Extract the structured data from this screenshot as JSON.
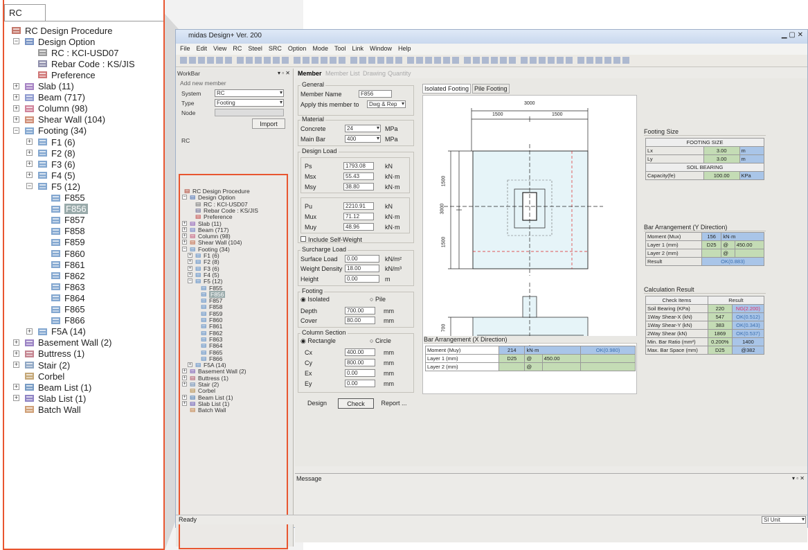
{
  "zoom_panel": {
    "tab": "RC",
    "tree": [
      {
        "label": "RC Design Procedure",
        "level": 0,
        "icon": "procedure-icon"
      },
      {
        "label": "Design Option",
        "level": 1,
        "icon": "design-option-icon",
        "toggle": "−"
      },
      {
        "label": "RC : KCI-USD07",
        "level": 2,
        "icon": "code-icon"
      },
      {
        "label": "Rebar Code : KS/JIS",
        "level": 2,
        "icon": "rebar-icon"
      },
      {
        "label": "Preference",
        "level": 2,
        "icon": "preference-icon"
      },
      {
        "label": "Slab (11)",
        "level": 1,
        "icon": "slab-icon",
        "toggle": "+"
      },
      {
        "label": "Beam (717)",
        "level": 1,
        "icon": "beam-icon",
        "toggle": "+"
      },
      {
        "label": "Column (98)",
        "level": 1,
        "icon": "column-icon",
        "toggle": "+"
      },
      {
        "label": "Shear Wall (104)",
        "level": 1,
        "icon": "shear-wall-icon",
        "toggle": "+"
      },
      {
        "label": "Footing (34)",
        "level": 1,
        "icon": "footing-icon",
        "toggle": "−"
      },
      {
        "label": "F1 (6)",
        "level": 2,
        "icon": "footing-group-icon",
        "toggle": "+"
      },
      {
        "label": "F2 (8)",
        "level": 2,
        "icon": "footing-group-icon",
        "toggle": "+"
      },
      {
        "label": "F3 (6)",
        "level": 2,
        "icon": "footing-group-icon",
        "toggle": "+"
      },
      {
        "label": "F4 (5)",
        "level": 2,
        "icon": "footing-group-icon",
        "toggle": "+"
      },
      {
        "label": "F5 (12)",
        "level": 2,
        "icon": "footing-group-icon",
        "toggle": "−"
      },
      {
        "label": "F855",
        "level": 3,
        "icon": "footing-member-icon"
      },
      {
        "label": "F856",
        "level": 3,
        "icon": "footing-member-icon",
        "selected": true
      },
      {
        "label": "F857",
        "level": 3,
        "icon": "footing-member-icon"
      },
      {
        "label": "F858",
        "level": 3,
        "icon": "footing-member-icon"
      },
      {
        "label": "F859",
        "level": 3,
        "icon": "footing-member-icon"
      },
      {
        "label": "F860",
        "level": 3,
        "icon": "footing-member-icon"
      },
      {
        "label": "F861",
        "level": 3,
        "icon": "footing-member-icon"
      },
      {
        "label": "F862",
        "level": 3,
        "icon": "footing-member-icon"
      },
      {
        "label": "F863",
        "level": 3,
        "icon": "footing-member-icon"
      },
      {
        "label": "F864",
        "level": 3,
        "icon": "footing-member-icon"
      },
      {
        "label": "F865",
        "level": 3,
        "icon": "footing-member-icon"
      },
      {
        "label": "F866",
        "level": 3,
        "icon": "footing-member-icon"
      },
      {
        "label": "F5A (14)",
        "level": 2,
        "icon": "footing-group-icon",
        "toggle": "+"
      },
      {
        "label": "Basement Wall (2)",
        "level": 1,
        "icon": "basement-wall-icon",
        "toggle": "+"
      },
      {
        "label": "Buttress (1)",
        "level": 1,
        "icon": "buttress-icon",
        "toggle": "+"
      },
      {
        "label": "Stair (2)",
        "level": 1,
        "icon": "stair-icon",
        "toggle": "+"
      },
      {
        "label": "Corbel",
        "level": 1,
        "icon": "corbel-icon"
      },
      {
        "label": "Beam List (1)",
        "level": 1,
        "icon": "beam-list-icon",
        "toggle": "+"
      },
      {
        "label": "Slab List (1)",
        "level": 1,
        "icon": "slab-list-icon",
        "toggle": "+"
      },
      {
        "label": "Batch Wall",
        "level": 1,
        "icon": "batch-wall-icon"
      }
    ]
  },
  "window": {
    "title": "midas Design+ Ver. 200",
    "menu": [
      "File",
      "Edit",
      "View",
      "RC",
      "Steel",
      "SRC",
      "Option",
      "Mode",
      "Tool",
      "Link",
      "Window",
      "Help"
    ],
    "workbar": {
      "title": "WorkBar",
      "add_new_member": "Add new member",
      "system_label": "System",
      "system_value": "RC",
      "type_label": "Type",
      "type_value": "Footing",
      "node_label": "Node",
      "import_label": "Import",
      "tree_tab": "RC"
    },
    "tabs": [
      "Member",
      "Member List",
      "Drawing",
      "Quantity"
    ],
    "member": {
      "general": "General",
      "member_name_label": "Member Name",
      "member_name": "F856",
      "apply_label": "Apply this member to",
      "apply_value": "Dwg & Rep",
      "material": "Material",
      "concrete_label": "Concrete",
      "concrete_value": "24",
      "concrete_unit": "MPa",
      "mainbar_label": "Main Bar",
      "mainbar_value": "400",
      "mainbar_unit": "MPa",
      "design_load": "Design Load",
      "ps": "1793.08",
      "msx": "55.43",
      "msy": "38.80",
      "pu": "2210.91",
      "mux": "71.12",
      "muy": "48.96",
      "l_ps": "Ps",
      "l_msx": "Msx",
      "l_msy": "Msy",
      "l_pu": "Pu",
      "l_mux": "Mux",
      "l_muy": "Muy",
      "u_kn": "kN",
      "u_knm": "kN·m",
      "self_weight": "Include Self-Weight",
      "surcharge": "Surcharge Load",
      "surface_label": "Surface Load",
      "surface_value": "0.00",
      "surface_unit": "kN/m²",
      "weight_label": "Weight Density",
      "weight_value": "18.00",
      "weight_unit": "kN/m³",
      "height_label": "Height",
      "height_value": "0.00",
      "height_unit": "m",
      "footing": "Footing",
      "isolated": "Isolated",
      "pile": "Pile",
      "depth_label": "Depth",
      "depth_value": "700.00",
      "cover_label": "Cover",
      "cover_value": "80.00",
      "u_mm": "mm",
      "column_section": "Column Section",
      "rectangle": "Rectangle",
      "circle": "Circle",
      "cx": "400.00",
      "cy": "800.00",
      "ex": "0.00",
      "ey": "0.00",
      "l_cx": "Cx",
      "l_cy": "Cy",
      "l_ex": "Ex",
      "l_ey": "Ey",
      "design_btn": "Design",
      "check_btn": "Check",
      "report_btn": "Report ..."
    },
    "drawing_tabs": [
      "Isolated Footing",
      "Pile Footing"
    ],
    "drawing": {
      "dim_top": "3000",
      "dim_a": "1500",
      "dim_b": "1500",
      "dim_left": "3000",
      "dim_l1": "1500",
      "dim_l2": "1500",
      "dim_depth": "700"
    },
    "footing_size": {
      "title": "Footing Size",
      "head": "FOOTING SIZE",
      "lx_label": "Lx",
      "lx": "3.00",
      "ly_label": "Ly",
      "ly": "3.00",
      "unit": "m",
      "soil_head": "SOIL BEARING",
      "cap_label": "Capacity(fe)",
      "cap": "100.00",
      "cap_unit": "KPa"
    },
    "bar_y": {
      "title": "Bar Arrangement (Y Direction)",
      "moment_label": "Moment (Mux)",
      "moment": "156",
      "moment_unit": "kN·m",
      "layer1_label": "Layer 1 (mm)",
      "layer1_bar": "D25",
      "at": "@",
      "layer1_sp": "450.00",
      "layer2_label": "Layer 2 (mm)",
      "result_label": "Result",
      "result": "OK(0.883)"
    },
    "calc": {
      "title": "Calculation Result",
      "h1": "Check Items",
      "h2": "Result",
      "rows": [
        [
          "Soil Bearing (KPa)",
          "220",
          "NG(2.200)"
        ],
        [
          "1Way Shear-X (kN)",
          "547",
          "OK(0.512)"
        ],
        [
          "1Way Shear-Y (kN)",
          "383",
          "OK(0.343)"
        ],
        [
          "2Way Shear (kN)",
          "1869",
          "OK(0.537)"
        ],
        [
          "Min. Bar Ratio (mm²)",
          "0.200%",
          "1400"
        ],
        [
          "Max. Bar Space (mm)",
          "D25",
          "@382"
        ]
      ]
    },
    "bar_x": {
      "title": "Bar Arrangement (X Direction)",
      "moment_label": "Moment (Muy)",
      "moment": "214",
      "moment_unit": "kN·m",
      "result": "OK(0.980)",
      "layer1_label": "Layer 1 (mm)",
      "layer1_bar": "D25",
      "at": "@",
      "layer1_sp": "450.00",
      "layer2_label": "Layer 2 (mm)"
    },
    "message": "Message",
    "status": "Ready",
    "unit_select": "SI Unit"
  },
  "colors": {
    "highlight": "#e8552f",
    "blue_cell": "#a9c5e8",
    "green_cell": "#c4dcb5",
    "ng": "#e0306a"
  }
}
